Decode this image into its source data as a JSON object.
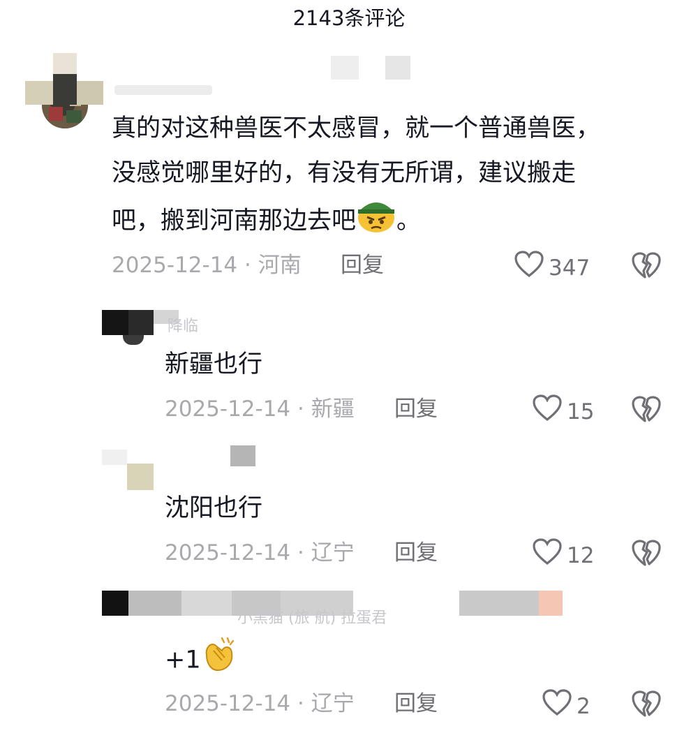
{
  "header": {
    "title": "2143条评论"
  },
  "main_comment": {
    "author_partial": "",
    "text_line1": "真的对这种兽医不太感冒，就一个普通兽医，",
    "text_line2": "没感觉哪里好的，有没有无所谓，建议搬走",
    "text_line3": "吧，搬到河南那边去吧",
    "text_tail": "。",
    "emoji": "angry-soldier-emoji",
    "date": "2025-12-14",
    "location": "河南",
    "reply_label": "回复",
    "likes": "347"
  },
  "replies": [
    {
      "author_partial": "降临",
      "text": "新疆也行",
      "date": "2025-12-14",
      "location": "新疆",
      "reply_label": "回复",
      "likes": "15"
    },
    {
      "author_partial": "",
      "text": "沈阳也行",
      "date": "2025-12-14",
      "location": "辽宁",
      "reply_label": "回复",
      "likes": "12"
    },
    {
      "author_partial": "小黑猫  (旅   航) 拉蛋君",
      "text": "+1",
      "emoji": "clapping-hands-emoji",
      "date": "2025-12-14",
      "location": "辽宁",
      "reply_label": "回复",
      "likes": "2"
    }
  ],
  "separator": " · ",
  "colors": {
    "text": "#161823",
    "meta": "#a8a8ad",
    "action": "#6f6f75"
  }
}
